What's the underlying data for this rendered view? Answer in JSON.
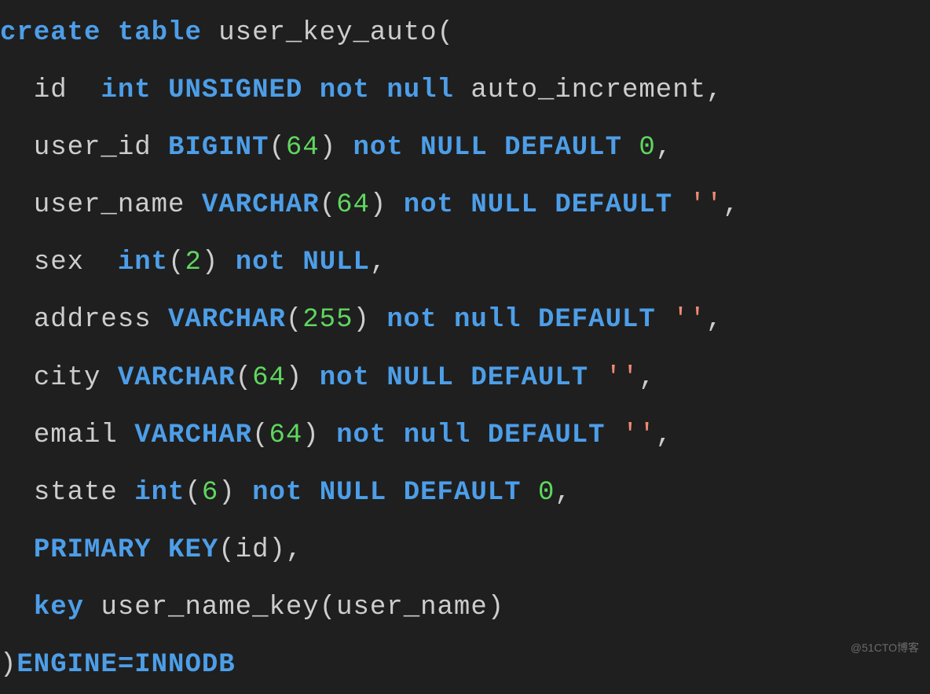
{
  "sql": {
    "l1": {
      "create": "create",
      "table": "table",
      "name": "user_key_auto"
    },
    "l2": {
      "col": "id",
      "int": "int",
      "unsigned": "UNSIGNED",
      "not": "not",
      "null": "null",
      "auto": "auto_increment"
    },
    "l3": {
      "col": "user_id",
      "bigint": "BIGINT",
      "size": "64",
      "not": "not",
      "null": "NULL",
      "default": "DEFAULT",
      "val": "0"
    },
    "l4": {
      "col": "user_name",
      "varchar": "VARCHAR",
      "size": "64",
      "not": "not",
      "null": "NULL",
      "default": "DEFAULT",
      "val": "''"
    },
    "l5": {
      "col": "sex",
      "int": "int",
      "size": "2",
      "not": "not",
      "null": "NULL"
    },
    "l6": {
      "col": "address",
      "varchar": "VARCHAR",
      "size": "255",
      "not": "not",
      "null": "null",
      "default": "DEFAULT",
      "val": "''"
    },
    "l7": {
      "col": "city",
      "varchar": "VARCHAR",
      "size": "64",
      "not": "not",
      "null": "NULL",
      "default": "DEFAULT",
      "val": "''"
    },
    "l8": {
      "col": "email",
      "varchar": "VARCHAR",
      "size": "64",
      "not": "not",
      "null": "null",
      "default": "DEFAULT",
      "val": "''"
    },
    "l9": {
      "col": "state",
      "int": "int",
      "size": "6",
      "not": "not",
      "null": "NULL",
      "default": "DEFAULT",
      "val": "0"
    },
    "l10": {
      "primary": "PRIMARY",
      "key": "KEY",
      "col": "id"
    },
    "l11": {
      "key": "key",
      "name": "user_name_key",
      "col": "user_name"
    },
    "l12": {
      "engine": "ENGINE=INNODB"
    }
  },
  "watermark": "@51CTO博客"
}
